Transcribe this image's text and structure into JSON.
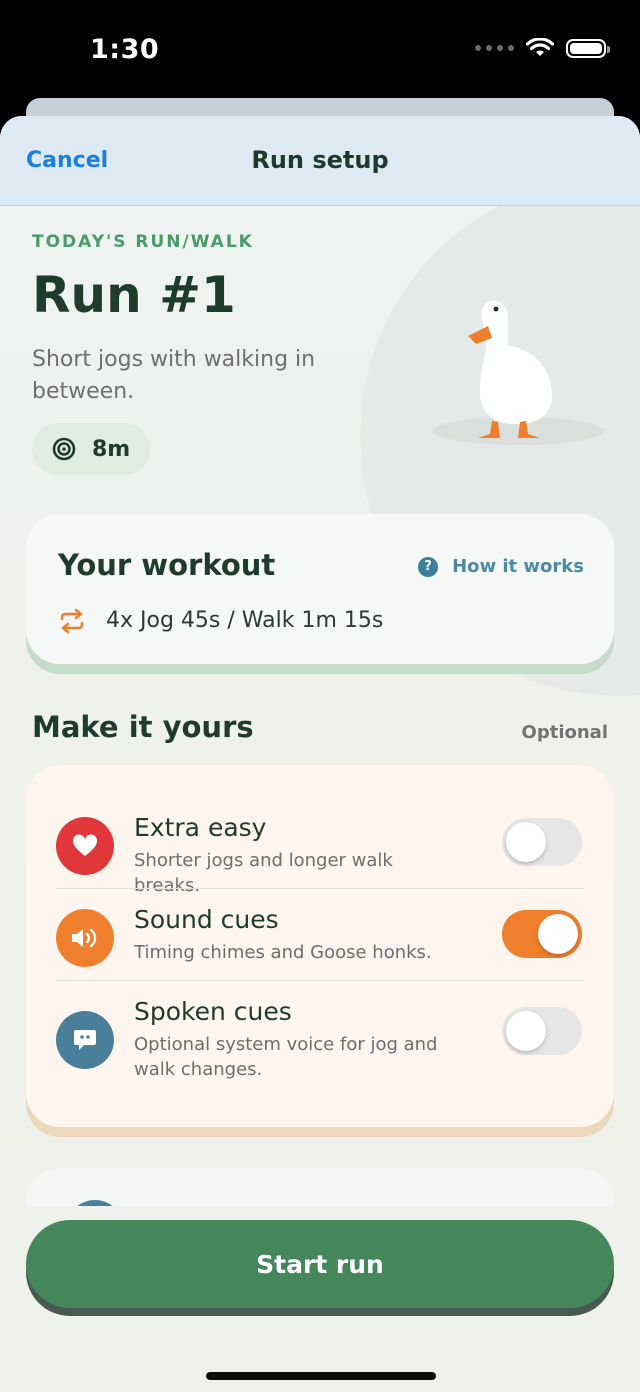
{
  "status_bar": {
    "time": "1:30"
  },
  "nav": {
    "cancel_label": "Cancel",
    "title": "Run setup"
  },
  "hero": {
    "overline": "TODAY'S RUN/WALK",
    "title": "Run #1",
    "description": "Short jogs with walking in between.",
    "duration": "8m"
  },
  "workout": {
    "title": "Your workout",
    "how_label": "How it works",
    "plan": "4x Jog 45s / Walk 1m 15s"
  },
  "customize": {
    "title": "Make it yours",
    "optional_label": "Optional",
    "options": [
      {
        "title": "Extra easy",
        "subtitle": "Shorter jogs and longer walk breaks.",
        "enabled": false,
        "icon": "heart-icon",
        "color": "#e0383a"
      },
      {
        "title": "Sound cues",
        "subtitle": "Timing chimes and Goose honks.",
        "enabled": true,
        "icon": "speaker-icon",
        "color": "#ef7f2c"
      },
      {
        "title": "Spoken cues",
        "subtitle": "Optional system voice for jog and walk changes.",
        "enabled": false,
        "icon": "speech-bubble-icon",
        "color": "#4a7f99"
      }
    ]
  },
  "footer": {
    "start_label": "Start run"
  },
  "colors": {
    "accent_green": "#43875b",
    "link_blue": "#1a7fe0",
    "toggle_on": "#ef7f2c"
  }
}
